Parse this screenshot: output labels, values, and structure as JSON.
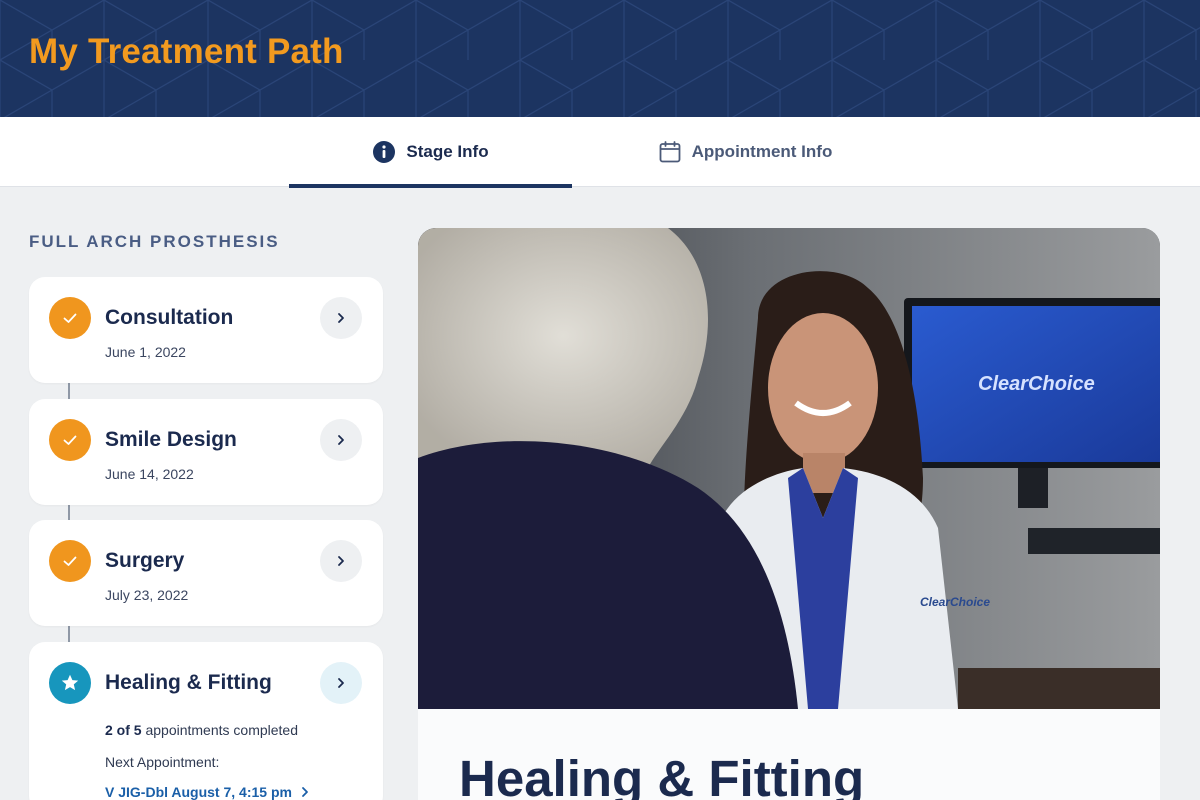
{
  "header": {
    "title": "My Treatment Path"
  },
  "tabs": {
    "stage_info": {
      "label": "Stage Info",
      "icon": "info-icon",
      "active": true
    },
    "appointment_info": {
      "label": "Appointment Info",
      "icon": "calendar-icon",
      "active": false
    }
  },
  "treatment": {
    "section_title": "FULL ARCH PROSTHESIS",
    "stages": [
      {
        "name": "Consultation",
        "date": "June 1, 2022",
        "status": "completed"
      },
      {
        "name": "Smile Design",
        "date": "June 14, 2022",
        "status": "completed"
      },
      {
        "name": "Surgery",
        "date": "July 23, 2022",
        "status": "completed"
      },
      {
        "name": "Healing & Fitting",
        "status": "current",
        "progress_count": "2 of 5",
        "progress_suffix": " appointments completed",
        "next_label": "Next Appointment:",
        "next_link": "V JIG-Dbl August 7, 4:15 pm"
      }
    ]
  },
  "detail": {
    "title": "Healing & Fitting"
  },
  "hero_image": {
    "screen_logo": "ClearChoice",
    "coat_logo": "ClearChoice"
  },
  "colors": {
    "header_bg": "#1c3461",
    "accent_orange": "#f0961e",
    "current_teal": "#1796bd",
    "link_blue": "#1a5fa8",
    "text_navy": "#1b2a4e"
  }
}
